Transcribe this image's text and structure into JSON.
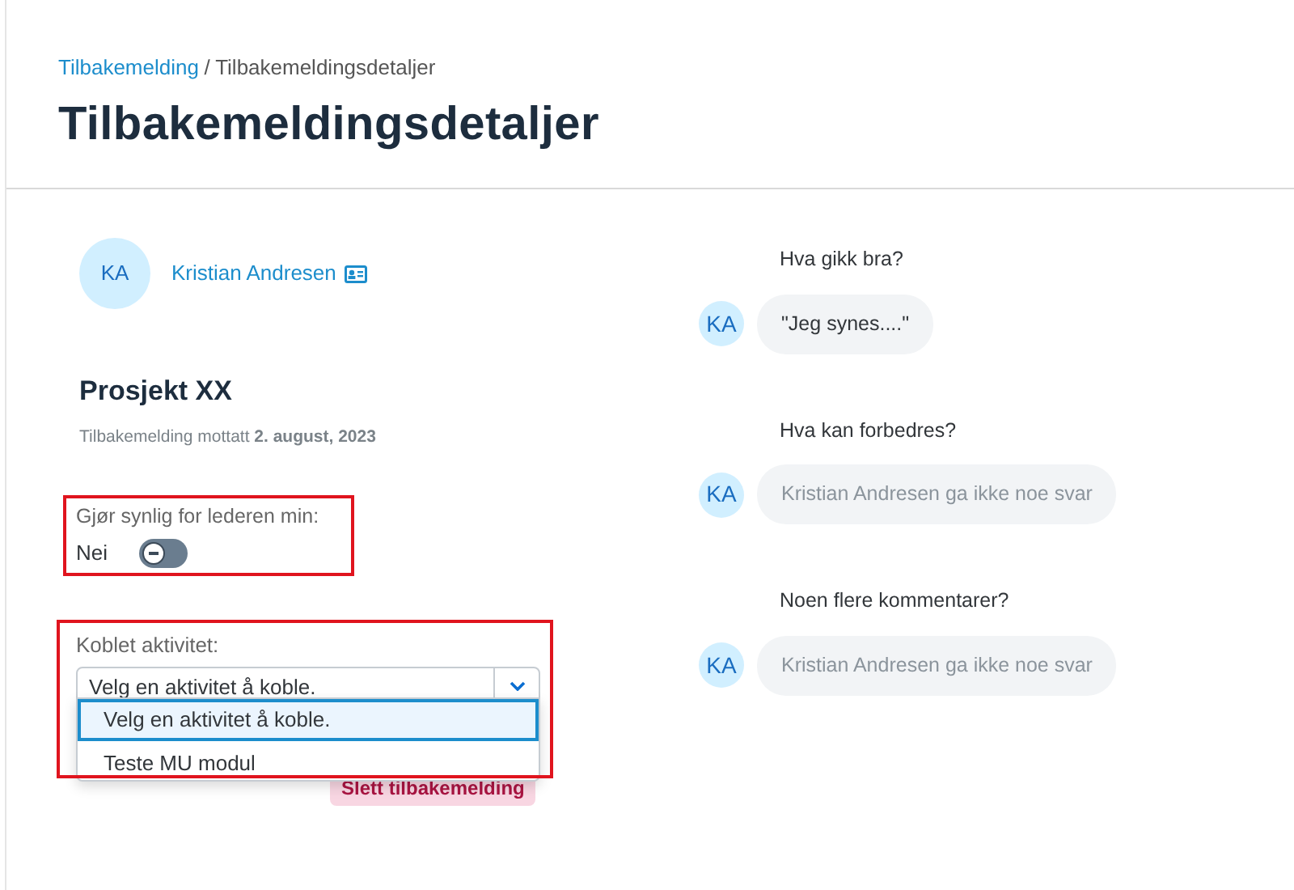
{
  "breadcrumb": {
    "separator": "/",
    "items": [
      {
        "label": "Tilbakemelding",
        "link": true
      },
      {
        "label": "Tilbakemeldingsdetaljer",
        "link": false
      }
    ]
  },
  "title": "Tilbakemeldingsdetaljer",
  "person": {
    "initials": "KA",
    "name": "Kristian Andresen"
  },
  "project": {
    "title": "Prosjekt XX",
    "received": "Tilbakemelding mottatt **2. august, 2023**"
  },
  "visibility": {
    "label": "Gjør synlig for lederen min:",
    "value": "Nei",
    "on": false,
    "highlighted": true
  },
  "activity": {
    "label": "Koblet aktivitet:",
    "value": "Velg en aktivitet å koble.",
    "expanded": true,
    "highlighted": true,
    "options": [
      {
        "label": "Velg en aktivitet å koble.",
        "selected": true
      },
      {
        "label": "Teste MU modul",
        "selected": false
      }
    ]
  },
  "delete_button": "Slett tilbakemelding",
  "questions": [
    {
      "question": "Hva gikk bra?",
      "initials": "KA",
      "answer": "\"Jeg synes....\"",
      "answered": true
    },
    {
      "question": "Hva kan forbedres?",
      "initials": "KA",
      "answer": "Kristian Andresen ga ikke noe svar",
      "answered": false
    },
    {
      "question": "Noen flere kommentarer?",
      "initials": "KA",
      "answer": "Kristian Andresen ga ikke noe svar",
      "answered": false
    }
  ]
}
